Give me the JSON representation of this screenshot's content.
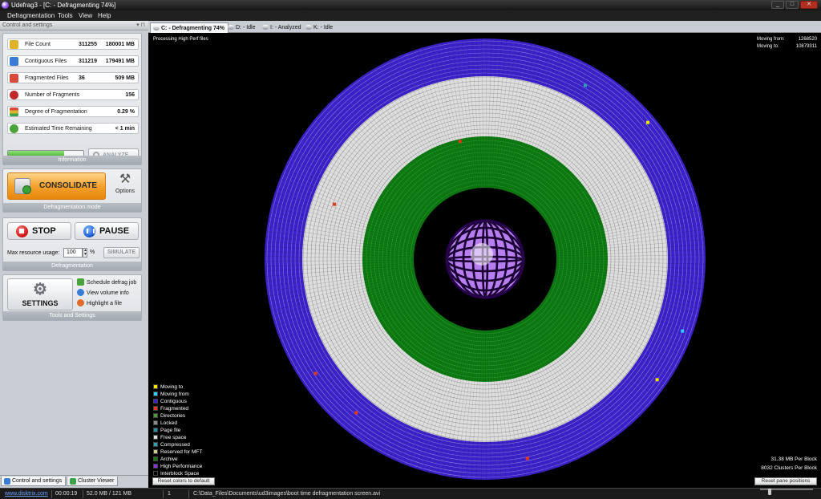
{
  "window": {
    "title": "Udefrag3 - [C: - Defragmenting 74%]"
  },
  "menu": [
    "Defragmentation",
    "Tools",
    "View",
    "Help"
  ],
  "left_panel": {
    "title": "Control and settings",
    "information": {
      "label": "Information",
      "stats": [
        {
          "label": "File Count",
          "v1": "311255",
          "v2": "180001 MB",
          "icon": "files-icon",
          "color": "#e0b12a"
        },
        {
          "label": "Contiguous Files",
          "v1": "311219",
          "v2": "179491 MB",
          "icon": "contiguous-files-icon",
          "color": "#3a7bd5"
        },
        {
          "label": "Fragmented Files",
          "v1": "36",
          "v2": "509 MB",
          "icon": "fragmented-files-icon",
          "color": "#d84a3a"
        },
        {
          "label": "Number of Fragments",
          "v1": "",
          "v2": "156",
          "icon": "fragments-icon",
          "color": "#c0282a"
        },
        {
          "label": "Degree of Fragmentation",
          "v1": "",
          "v2": "0.29 %",
          "icon": "fragmentation-degree-icon",
          "color": "#3aa24a"
        },
        {
          "label": "Estimated Time Remaining",
          "v1": "",
          "v2": "< 1 min",
          "icon": "clock-icon",
          "color": "#4aa23a"
        }
      ],
      "progress_percent": 74,
      "analyze_label": "ANALYZE"
    },
    "mode": {
      "label": "Defragmentation mode",
      "consolidate_label": "CONSOLIDATE",
      "options_label": "Options"
    },
    "defrag": {
      "label": "Defragmentation",
      "stop_label": "STOP",
      "pause_label": "PAUSE",
      "max_resource_label": "Max resource usage:",
      "max_resource_value": "100",
      "percent": "%",
      "simulate_label": "SIMULATE"
    },
    "tools": {
      "label": "Tools and Settings",
      "settings_label": "SETTINGS",
      "links": [
        "Schedule defrag job",
        "View volume info",
        "Highlight a file"
      ]
    },
    "bottom_tabs": [
      "Control and settings",
      "Cluster Viewer"
    ]
  },
  "volume_tabs": [
    "C: - Defragmenting 74%",
    "D: - Idle",
    "I: - Analyzed",
    "K: - Idle"
  ],
  "viewer": {
    "processing_text": "Processing High Perf files",
    "moving_from_label": "Moving from:",
    "moving_from_value": "1268520",
    "moving_to_label": "Moving to:",
    "moving_to_value": "10879311",
    "legend": [
      {
        "label": "Moving to",
        "color": "#f4e400"
      },
      {
        "label": "Moving from",
        "color": "#2ad0ff"
      },
      {
        "label": "Contiguous",
        "color": "#3a22c8"
      },
      {
        "label": "Fragmented",
        "color": "#e03a1a"
      },
      {
        "label": "Directories",
        "color": "#4a9a3a"
      },
      {
        "label": "Locked",
        "color": "#8a8a8a"
      },
      {
        "label": "Page file",
        "color": "#2a8aa0"
      },
      {
        "label": "Free space",
        "color": "#dedede"
      },
      {
        "label": "Compressed",
        "color": "#2aa0b0"
      },
      {
        "label": "Reserved for MFT",
        "color": "#c8c890"
      },
      {
        "label": "Archive",
        "color": "#0d7a12"
      },
      {
        "label": "High Performance",
        "color": "#8a30e0"
      },
      {
        "label": "Interblock Space",
        "color": "#000000"
      }
    ],
    "reset_colors_label": "Reset colors to default",
    "reset_pane_label": "Reset pane positions",
    "mb_per_block": "31.38 MB Per Block",
    "clusters_per_block": "8032 Clusters Per Block"
  },
  "statusbar": {
    "website": "www.disktrix.com",
    "time": "00:00:19",
    "memory": "52.0 MB / 121 MB",
    "counter": "1",
    "file": "C:\\Data_Files\\Documents\\ud3images\\boot time defragmentation screen.avi"
  }
}
